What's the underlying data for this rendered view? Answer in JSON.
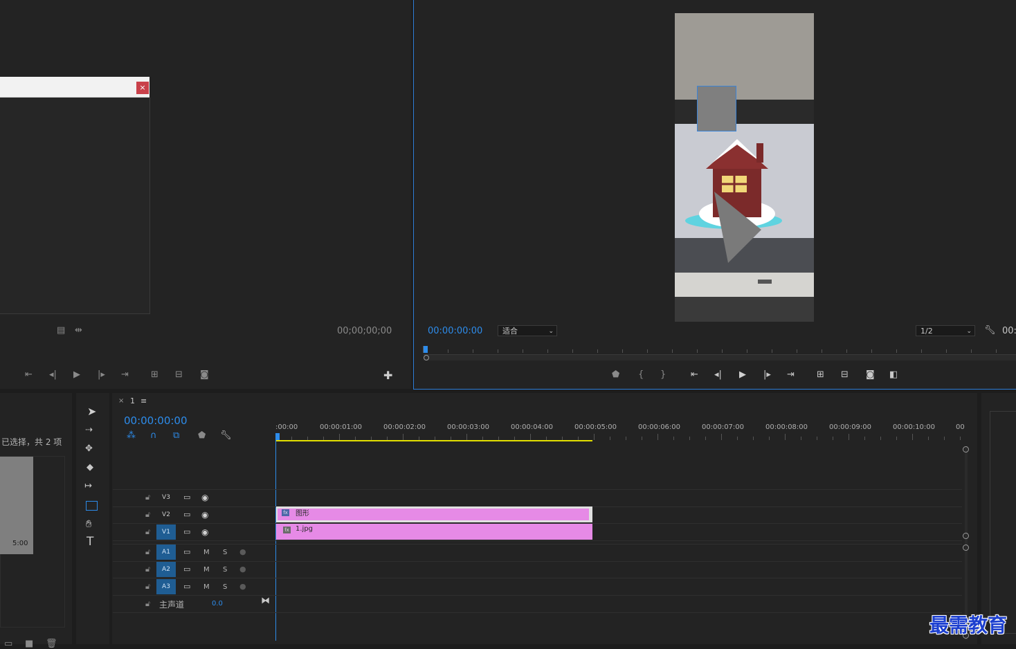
{
  "source_monitor": {
    "timecode": "00;00;00;00"
  },
  "program_monitor": {
    "timecode": "00:00:00:00",
    "fit": "适合",
    "resolution": "1/2",
    "timecode_right": "00:"
  },
  "dialog": {
    "close_glyph": "×"
  },
  "project_panel": {
    "selection_info": "已选择，共 2 项",
    "thumb_duration": "5:00"
  },
  "timeline": {
    "close_glyph": "×",
    "sequence_name": "1",
    "menu_glyph": "≡",
    "timecode": "00:00:00:00",
    "ruler": [
      ":00:00",
      "00:00:01:00",
      "00:00:02:00",
      "00:00:03:00",
      "00:00:04:00",
      "00:00:05:00",
      "00:00:06:00",
      "00:00:07:00",
      "00:00:08:00",
      "00:00:09:00",
      "00:00:10:00",
      "00"
    ],
    "tracks_video": [
      "V3",
      "V2",
      "V1"
    ],
    "tracks_audio": [
      "A1",
      "A2",
      "A3"
    ],
    "audio_m": "M",
    "audio_s": "S",
    "master_label": "主声道",
    "master_value": "0.0",
    "clips": {
      "graphic": "图形",
      "image": "1.jpg",
      "fx": "fx"
    }
  },
  "colors": {
    "accent": "#2d8ceb",
    "clip": "#e68ae6",
    "track_on": "#1f5d93",
    "work_area": "#e3e000"
  },
  "watermark": "最需教育"
}
